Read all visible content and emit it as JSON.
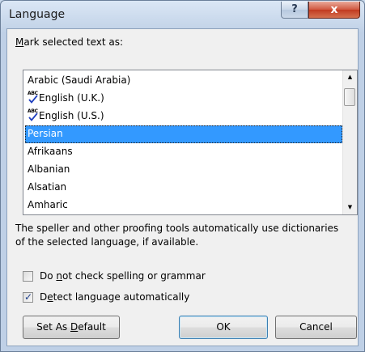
{
  "window": {
    "title": "Language",
    "help_label": "?",
    "close_label": "x"
  },
  "mark_label": {
    "accel": "M",
    "rest": "ark selected text as:"
  },
  "languages": [
    {
      "name": "Arabic (Saudi Arabia)",
      "spellcheck": false,
      "selected": false
    },
    {
      "name": "English (U.K.)",
      "spellcheck": true,
      "selected": false
    },
    {
      "name": "English (U.S.)",
      "spellcheck": true,
      "selected": false
    },
    {
      "name": "Persian",
      "spellcheck": false,
      "selected": true
    },
    {
      "name": "Afrikaans",
      "spellcheck": false,
      "selected": false
    },
    {
      "name": "Albanian",
      "spellcheck": false,
      "selected": false
    },
    {
      "name": "Alsatian",
      "spellcheck": false,
      "selected": false
    },
    {
      "name": "Amharic",
      "spellcheck": false,
      "selected": false
    }
  ],
  "spell_icon_text": "ABC",
  "scrollbar": {
    "up_glyph": "▲",
    "down_glyph": "▼"
  },
  "info_text": "The speller and other proofing tools automatically use dictionaries of the selected language, if available.",
  "options": {
    "no_check": {
      "pre": "Do ",
      "accel": "n",
      "post": "ot check spelling or grammar",
      "checked": false
    },
    "detect": {
      "pre": "D",
      "accel": "e",
      "post": "tect language automatically",
      "checked": true
    }
  },
  "buttons": {
    "set_default": {
      "pre": "Set As ",
      "accel": "D",
      "post": "efault"
    },
    "ok": "OK",
    "cancel": "Cancel"
  },
  "colors": {
    "selection": "#3399ff",
    "close_button": "#c13a20",
    "title_bar": "#c6d6ea"
  }
}
